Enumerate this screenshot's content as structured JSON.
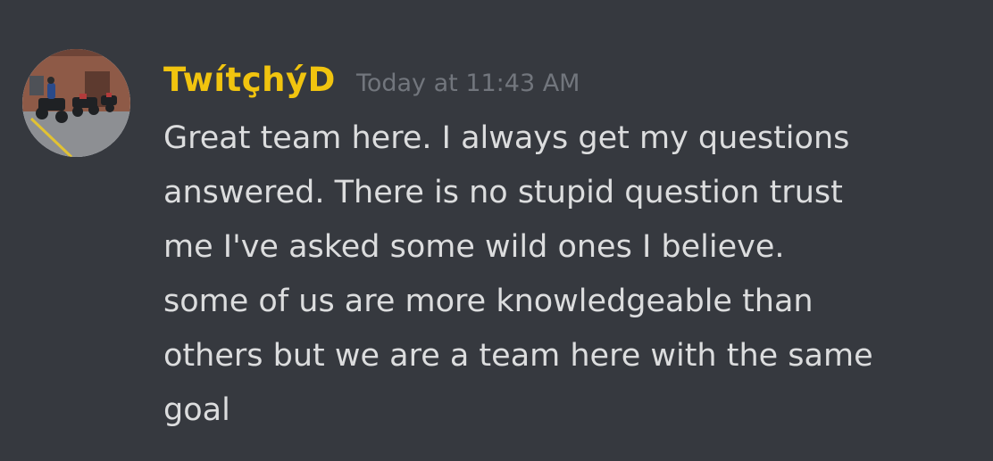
{
  "message": {
    "author": "TwítçhýD",
    "timestamp": "Today at 11:43 AM",
    "text": "Great team here. I always get my questions\nanswered. There is no stupid question trust\nme I've asked some wild ones I believe.\nsome of us are more knowledgeable than\nothers but we are a team here with the same\ngoal"
  },
  "colors": {
    "background": "#36393f",
    "author_color": "#f1c40f",
    "timestamp_color": "#72767d",
    "text_color": "#dcddde"
  }
}
